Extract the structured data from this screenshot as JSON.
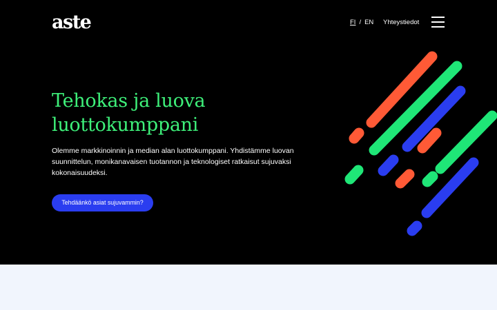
{
  "header": {
    "logo_text": "aste",
    "lang_fi": "FI",
    "lang_separator": "/",
    "lang_en": "EN",
    "contact_label": "Yhteystiedot",
    "menu_icon": "hamburger-menu-icon"
  },
  "hero": {
    "heading_line1": "Tehokas ja luova",
    "heading_line2": "luottokumppani",
    "lead": "Olemme markkinoinnin ja median alan luottokumppani. Yhdistämme luovan suunnittelun, monikanavaisen tuotannon ja teknologiset ratkaisut sujuvaksi kokonaisuudeksi.",
    "cta_label": "Tehdäänkö asiat sujuvammin?"
  },
  "decoration": {
    "name": "diagonal-stripes-graphic",
    "colors": {
      "orange": "#ff5a36",
      "green": "#1fe677",
      "blue": "#2a3df0"
    }
  },
  "colors": {
    "hero_background": "#000000",
    "heading_green": "#3ef07a",
    "accent_blue": "#2a3df0",
    "section_background": "#f1f5fd"
  }
}
